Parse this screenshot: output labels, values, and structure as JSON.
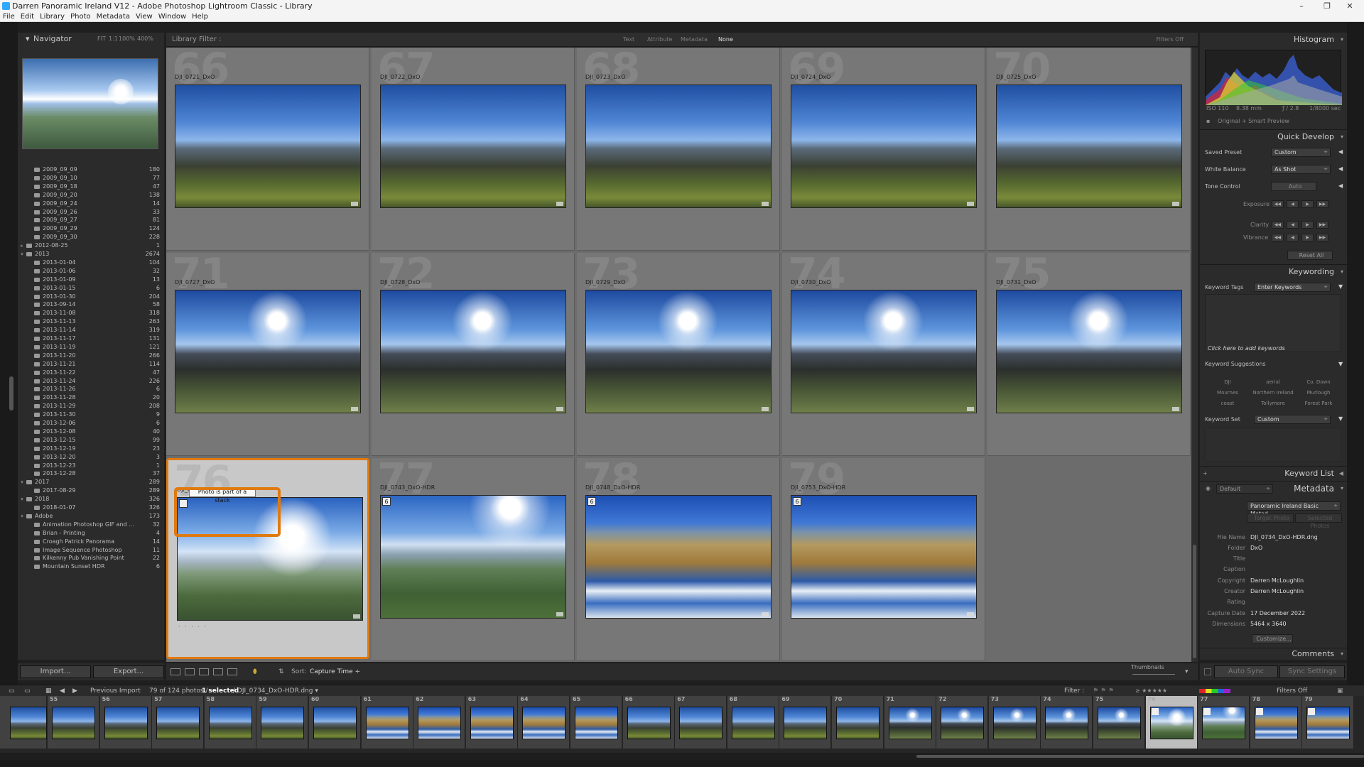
{
  "window": {
    "title": "Darren Panoramic Ireland V12 - Adobe Photoshop Lightroom Classic - Library",
    "minimize": "–",
    "maximize": "❐",
    "close": "✕"
  },
  "menu": [
    "File",
    "Edit",
    "Library",
    "Photo",
    "Metadata",
    "View",
    "Window",
    "Help"
  ],
  "navigator": {
    "title": "Navigator",
    "modes": [
      "FIT",
      "1:1",
      "100%",
      "400%"
    ]
  },
  "folders": [
    {
      "name": "2009_09_09",
      "count": "180",
      "level": 2
    },
    {
      "name": "2009_09_10",
      "count": "77",
      "level": 2
    },
    {
      "name": "2009_09_18",
      "count": "47",
      "level": 2
    },
    {
      "name": "2009_09_20",
      "count": "138",
      "level": 2
    },
    {
      "name": "2009_09_24",
      "count": "14",
      "level": 2
    },
    {
      "name": "2009_09_26",
      "count": "33",
      "level": 2
    },
    {
      "name": "2009_09_27",
      "count": "81",
      "level": 2
    },
    {
      "name": "2009_09_29",
      "count": "124",
      "level": 2
    },
    {
      "name": "2009_09_30",
      "count": "228",
      "level": 2
    },
    {
      "name": "2012-08-25",
      "count": "1",
      "level": 1
    },
    {
      "name": "2013",
      "count": "2674",
      "level": 1,
      "open": true
    },
    {
      "name": "2013-01-04",
      "count": "104",
      "level": 2
    },
    {
      "name": "2013-01-06",
      "count": "32",
      "level": 2
    },
    {
      "name": "2013-01-09",
      "count": "13",
      "level": 2
    },
    {
      "name": "2013-01-15",
      "count": "6",
      "level": 2
    },
    {
      "name": "2013-01-30",
      "count": "204",
      "level": 2
    },
    {
      "name": "2013-09-14",
      "count": "58",
      "level": 2
    },
    {
      "name": "2013-11-08",
      "count": "318",
      "level": 2
    },
    {
      "name": "2013-11-13",
      "count": "263",
      "level": 2
    },
    {
      "name": "2013-11-14",
      "count": "319",
      "level": 2
    },
    {
      "name": "2013-11-17",
      "count": "131",
      "level": 2
    },
    {
      "name": "2013-11-19",
      "count": "121",
      "level": 2
    },
    {
      "name": "2013-11-20",
      "count": "266",
      "level": 2
    },
    {
      "name": "2013-11-21",
      "count": "114",
      "level": 2
    },
    {
      "name": "2013-11-22",
      "count": "47",
      "level": 2
    },
    {
      "name": "2013-11-24",
      "count": "226",
      "level": 2
    },
    {
      "name": "2013-11-26",
      "count": "6",
      "level": 2
    },
    {
      "name": "2013-11-28",
      "count": "20",
      "level": 2
    },
    {
      "name": "2013-11-29",
      "count": "208",
      "level": 2
    },
    {
      "name": "2013-11-30",
      "count": "9",
      "level": 2
    },
    {
      "name": "2013-12-06",
      "count": "6",
      "level": 2
    },
    {
      "name": "2013-12-08",
      "count": "40",
      "level": 2
    },
    {
      "name": "2013-12-15",
      "count": "99",
      "level": 2
    },
    {
      "name": "2013-12-19",
      "count": "23",
      "level": 2
    },
    {
      "name": "2013-12-20",
      "count": "3",
      "level": 2
    },
    {
      "name": "2013-12-23",
      "count": "1",
      "level": 2
    },
    {
      "name": "2013-12-28",
      "count": "37",
      "level": 2
    },
    {
      "name": "2017",
      "count": "289",
      "level": 1,
      "open": true
    },
    {
      "name": "2017-08-29",
      "count": "289",
      "level": 2
    },
    {
      "name": "2018",
      "count": "326",
      "level": 1,
      "open": true
    },
    {
      "name": "2018-01-07",
      "count": "326",
      "level": 2
    },
    {
      "name": "Adobe",
      "count": "173",
      "level": 1,
      "open": true
    },
    {
      "name": "Animation Photoshop GIF and ...",
      "count": "32",
      "level": 2
    },
    {
      "name": "Brian - Printing",
      "count": "4",
      "level": 2
    },
    {
      "name": "Croagh Patrick Panorama",
      "count": "14",
      "level": 2
    },
    {
      "name": "Image Sequence Photoshop",
      "count": "11",
      "level": 2
    },
    {
      "name": "Kilkenny Pub Vanishing Point",
      "count": "22",
      "level": 2
    },
    {
      "name": "Mountain Sunset HDR",
      "count": "6",
      "level": 2
    }
  ],
  "left_buttons": {
    "import": "Import...",
    "export": "Export..."
  },
  "library_filter": {
    "title": "Library Filter :",
    "options": [
      "Text",
      "Attribute",
      "Metadata",
      "None"
    ],
    "active": "None",
    "filters_off": "Filters Off"
  },
  "grid": [
    {
      "num": "66",
      "name": "DJI_0721_DxO",
      "type": "day"
    },
    {
      "num": "67",
      "name": "DJI_0722_DxO",
      "type": "day"
    },
    {
      "num": "68",
      "name": "DJI_0723_DxO",
      "type": "day"
    },
    {
      "num": "69",
      "name": "DJI_0724_DxO",
      "type": "day"
    },
    {
      "num": "70",
      "name": "DJI_0725_DxO",
      "type": "day"
    },
    {
      "num": "71",
      "name": "DJI_0727_DxO",
      "type": "sun"
    },
    {
      "num": "72",
      "name": "DJI_0728_DxO",
      "type": "sun"
    },
    {
      "num": "73",
      "name": "DJI_0729_DxO",
      "type": "sun"
    },
    {
      "num": "74",
      "name": "DJI_0730_DxO",
      "type": "sun"
    },
    {
      "num": "75",
      "name": "DJI_0731_DxO",
      "type": "sun"
    },
    {
      "num": "76",
      "name": "DJI_0734_DxO-HDR",
      "type": "hdr",
      "badge": "",
      "selected": true
    },
    {
      "num": "77",
      "name": "DJI_0743_DxO-HDR",
      "type": "hdr2",
      "badge": "6"
    },
    {
      "num": "78",
      "name": "DJI_0748_DxO-HDR",
      "type": "snow",
      "badge": "6"
    },
    {
      "num": "79",
      "name": "DJI_0753_DxO-HDR",
      "type": "snow",
      "badge": "6"
    }
  ],
  "tooltip": "Photo is part of a stack",
  "toolbar": {
    "sort_label": "Sort:",
    "sort_value": "Capture Time ÷",
    "thumbnails": "Thumbnails"
  },
  "histogram": {
    "title": "Histogram",
    "iso": "ISO 110",
    "focal": "8.38 mm",
    "aperture": "ƒ / 2.8",
    "shutter": "1/8000 sec",
    "preview": "Original + Smart Preview"
  },
  "quick_develop": {
    "title": "Quick Develop",
    "saved_preset_label": "Saved Preset",
    "saved_preset": "Custom",
    "wb_label": "White Balance",
    "wb": "As Shot",
    "tone_label": "Tone Control",
    "tone": "Auto",
    "exposure": "Exposure",
    "clarity": "Clarity",
    "vibrance": "Vibrance",
    "reset": "Reset All"
  },
  "keywording": {
    "title": "Keywording",
    "tags_label": "Keyword Tags",
    "tags_value": "Enter Keywords",
    "hint": "Click here to add keywords",
    "suggestions_label": "Keyword Suggestions",
    "suggestions": [
      "DJI",
      "aerial",
      "Co. Down",
      "Mournes",
      "Northern Ireland",
      "Murlough",
      "coast",
      "Tollymore",
      "Forest Park"
    ],
    "set_label": "Keyword Set",
    "set_value": "Custom"
  },
  "keyword_list": {
    "title": "Keyword List"
  },
  "metadata": {
    "title": "Metadata",
    "default": "Default",
    "preset_label": "Preset",
    "preset": "Panoramic Ireland Basic Metad...",
    "target_photo": "Target Photo",
    "selected_photos": "Selected Photos",
    "fields": [
      {
        "label": "File Name",
        "value": "DJI_0734_DxO-HDR.dng"
      },
      {
        "label": "Folder",
        "value": "DxO"
      },
      {
        "label": "Title",
        "value": ""
      },
      {
        "label": "Caption",
        "value": ""
      },
      {
        "label": "Copyright",
        "value": "Darren McLoughlin"
      },
      {
        "label": "Creator",
        "value": "Darren McLoughlin"
      },
      {
        "label": "Rating",
        "value": ""
      },
      {
        "label": "Capture Date",
        "value": "17 December 2022"
      },
      {
        "label": "Dimensions",
        "value": "5464 x 3640"
      }
    ],
    "customize": "Customize..."
  },
  "comments": {
    "title": "Comments"
  },
  "right_buttons": {
    "auto_sync": "Auto Sync",
    "sync_settings": "Sync Settings"
  },
  "filmstrip": {
    "prev_import": "Previous Import",
    "count_text": "79 of 124 photos /",
    "selected_text": "1 selected",
    "file_text": "/ DJI_0734_DxO-HDR.dng ▾",
    "filter_label": "Filter :",
    "filters_off": "Filters Off",
    "numbers": [
      "55",
      "56",
      "57",
      "58",
      "59",
      "60",
      "61",
      "62",
      "63",
      "64",
      "65",
      "66",
      "67",
      "68",
      "69",
      "70",
      "71",
      "72",
      "73",
      "74",
      "75",
      "76",
      "77",
      "78",
      "79"
    ],
    "selected": "76"
  },
  "colors": {
    "accent": "#e07a10",
    "panel": "#2b2b2b",
    "grid": "#6c6c6c"
  }
}
